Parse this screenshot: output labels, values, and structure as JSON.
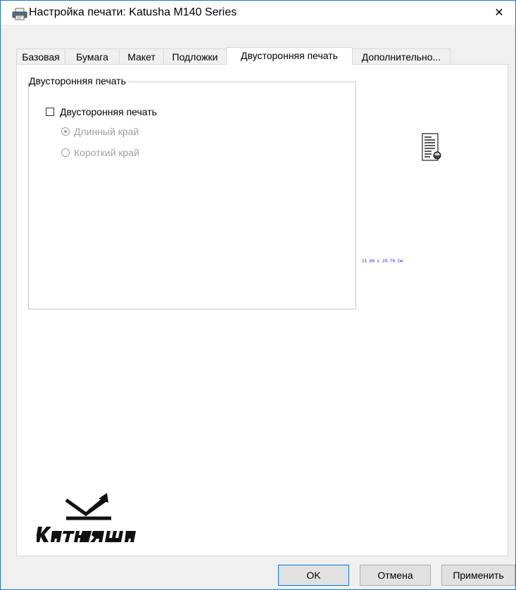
{
  "window": {
    "title": "Настройка печати: Katusha M140 Series",
    "close_glyph": "✕"
  },
  "tabs": [
    {
      "label": "Базовая",
      "active": false
    },
    {
      "label": "Бумага",
      "active": false
    },
    {
      "label": "Макет",
      "active": false
    },
    {
      "label": "Подложки",
      "active": false
    },
    {
      "label": "Двусторонняя печать",
      "active": true
    },
    {
      "label": "Дополнительно...",
      "active": false
    }
  ],
  "duplex_group": {
    "legend": "Двусторонняя печать",
    "checkbox_label": "Двусторонняя печать",
    "checkbox_checked": false,
    "option_long_edge": "Длинный край",
    "option_short_edge": "Короткий край",
    "selected_option": "Длинный край",
    "options_enabled": false
  },
  "preview": {
    "icon": "document-page-icon",
    "paper_size": "21.00 x 29.70 См"
  },
  "logo": {
    "text": "КАТЮША"
  },
  "buttons": {
    "ok": "OK",
    "cancel": "Отмена",
    "apply": "Применить"
  },
  "colors": {
    "accent_border": "#1979ca",
    "default_button_border": "#0078d7",
    "paper_size_text": "#2323ff",
    "disabled_text": "#a0a0a0"
  }
}
